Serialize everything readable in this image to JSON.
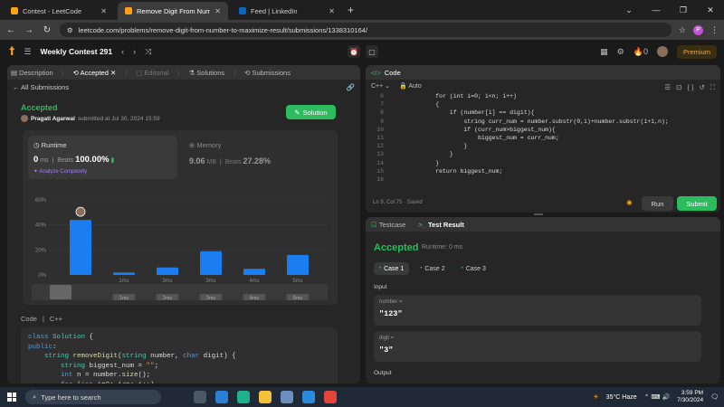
{
  "browser": {
    "tabs": [
      {
        "title": "Contest - LeetCode",
        "color": "#ffa116",
        "active": false
      },
      {
        "title": "Remove Digit From Number to",
        "color": "#ffa116",
        "active": true
      },
      {
        "title": "Feed | LinkedIn",
        "color": "#0a66c2",
        "active": false
      }
    ],
    "url": "leetcode.com/problems/remove-digit-from-number-to-maximize-result/submissions/1338310164/",
    "profile_initial": "P"
  },
  "lcnav": {
    "contest_title": "Weekly Contest 291",
    "notifications": "0",
    "premium": "Premium"
  },
  "left": {
    "tabs": [
      "Description",
      "Accepted",
      "Editorial",
      "Solutions",
      "Submissions"
    ],
    "all_submissions": "All Submissions",
    "status": "Accepted",
    "user": "Pragati Agarwal",
    "submitted_text": "submitted at Jul 30, 2024 15:59",
    "solution_btn": "Solution",
    "runtime": {
      "label": "Runtime",
      "value": "0",
      "unit": "ms",
      "beats_label": "Beats",
      "beats": "100.00%",
      "analyze": "Analyze Complexity"
    },
    "memory": {
      "label": "Memory",
      "value": "9.06",
      "unit": "MB",
      "beats_label": "Beats",
      "beats": "27.28%"
    },
    "code_label": "Code",
    "lang": "C++",
    "code_lines": [
      "class Solution {",
      "public:",
      "    string removeDigit(string number, char digit) {",
      "        string biggest_num = \"\";",
      "        int n = number.size();",
      "        for (int i=0; i<n; i++)"
    ]
  },
  "chart_data": {
    "type": "bar",
    "categories": [
      "0ms",
      "1ms",
      "3ms",
      "3ms",
      "4ms",
      "5ms"
    ],
    "values": [
      44,
      2,
      6,
      19,
      5,
      16
    ],
    "y_ticks": [
      "60%",
      "40%",
      "20%",
      "0%"
    ],
    "ylim": [
      0,
      60
    ],
    "highlight_index": 0,
    "bar_color": "#1a7ef0",
    "range_labels": [
      "1ms",
      "2ms",
      "3ms",
      "4ms",
      "5ms"
    ]
  },
  "code": {
    "header": "Code",
    "lang": "C++",
    "mode": "Auto",
    "lines": [
      {
        "n": "6",
        "t": "        for (int i=0; i<n; i++)"
      },
      {
        "n": "7",
        "t": "        {"
      },
      {
        "n": "8",
        "t": "            if (number[i] == digit){"
      },
      {
        "n": "9",
        "t": "                string curr_num = number.substr(0,i)+number.substr(i+1,n);"
      },
      {
        "n": "10",
        "t": "                if (curr_num>biggest_num){"
      },
      {
        "n": "11",
        "t": "                    biggest_num = curr_num;"
      },
      {
        "n": "12",
        "t": "                }"
      },
      {
        "n": "13",
        "t": "            }"
      },
      {
        "n": "14",
        "t": "        }"
      },
      {
        "n": "15",
        "t": "        return biggest_num;"
      },
      {
        "n": "16",
        "t": ""
      }
    ],
    "status": "Ln 9, Col 75  ·  Saved",
    "run": "Run",
    "submit": "Submit"
  },
  "test": {
    "tabs": [
      "Testcase",
      "Test Result"
    ],
    "status": "Accepted",
    "runtime": "Runtime: 0 ms",
    "cases": [
      "Case 1",
      "Case 2",
      "Case 3"
    ],
    "input_label": "Input",
    "vars": [
      {
        "name": "number =",
        "value": "\"123\""
      },
      {
        "name": "digit =",
        "value": "\"3\""
      }
    ],
    "output_label": "Output"
  },
  "taskbar": {
    "search": "Type here to search",
    "weather": "35°C  Haze",
    "time": "3:59 PM",
    "date": "7/30/2024"
  }
}
